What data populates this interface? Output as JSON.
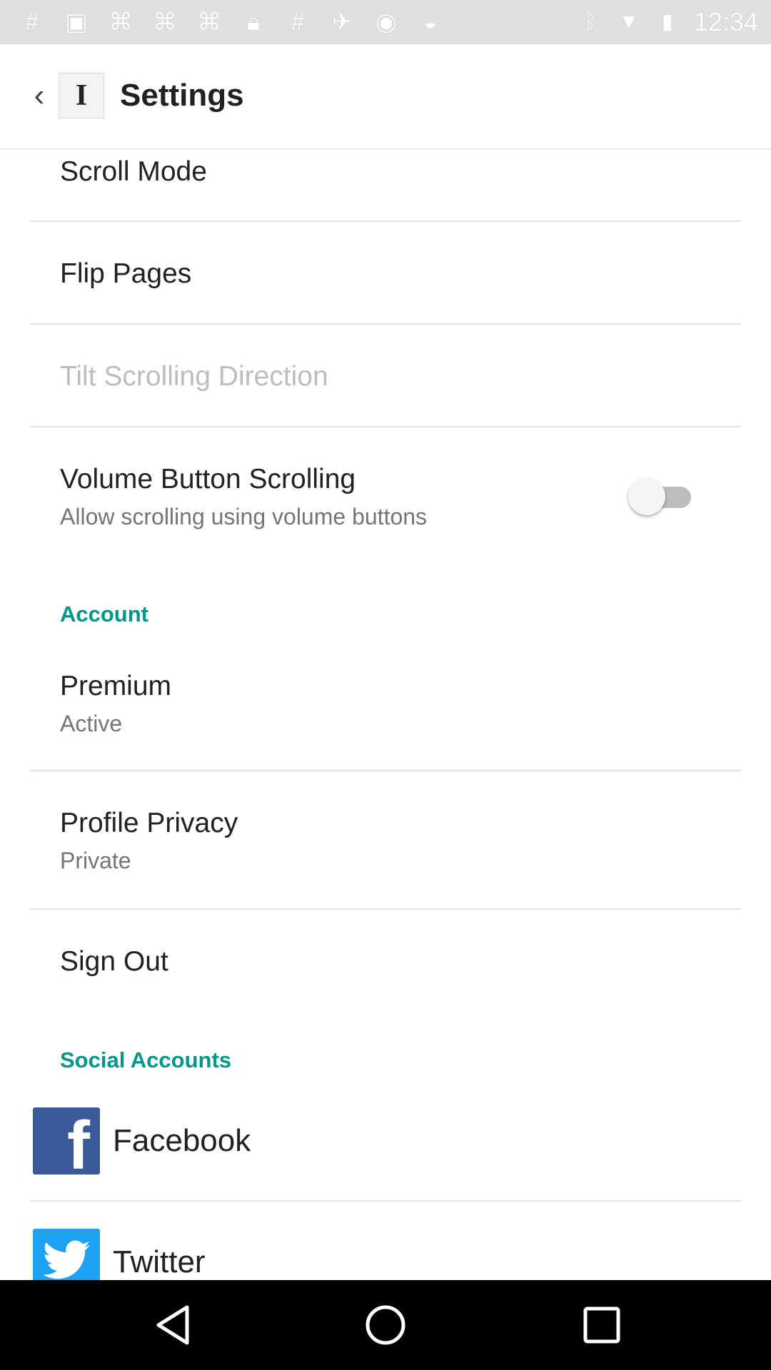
{
  "status_bar": {
    "time": "12:34"
  },
  "app_bar": {
    "title": "Settings",
    "logo_letter": "I"
  },
  "reading": {
    "scroll_mode": "Scroll Mode",
    "flip_pages": "Flip Pages",
    "tilt_scrolling": "Tilt Scrolling Direction",
    "volume_scrolling": {
      "title": "Volume Button Scrolling",
      "summary": "Allow scrolling using volume buttons",
      "enabled": false
    }
  },
  "account": {
    "header": "Account",
    "premium": {
      "title": "Premium",
      "summary": "Active"
    },
    "privacy": {
      "title": "Profile Privacy",
      "summary": "Private"
    },
    "sign_out": "Sign Out"
  },
  "social": {
    "header": "Social Accounts",
    "items": [
      {
        "label": "Facebook",
        "icon": "facebook-icon"
      },
      {
        "label": "Twitter",
        "icon": "twitter-icon"
      }
    ]
  },
  "colors": {
    "accent": "#009688",
    "facebook": "#3b5998",
    "twitter": "#1da1f2"
  }
}
